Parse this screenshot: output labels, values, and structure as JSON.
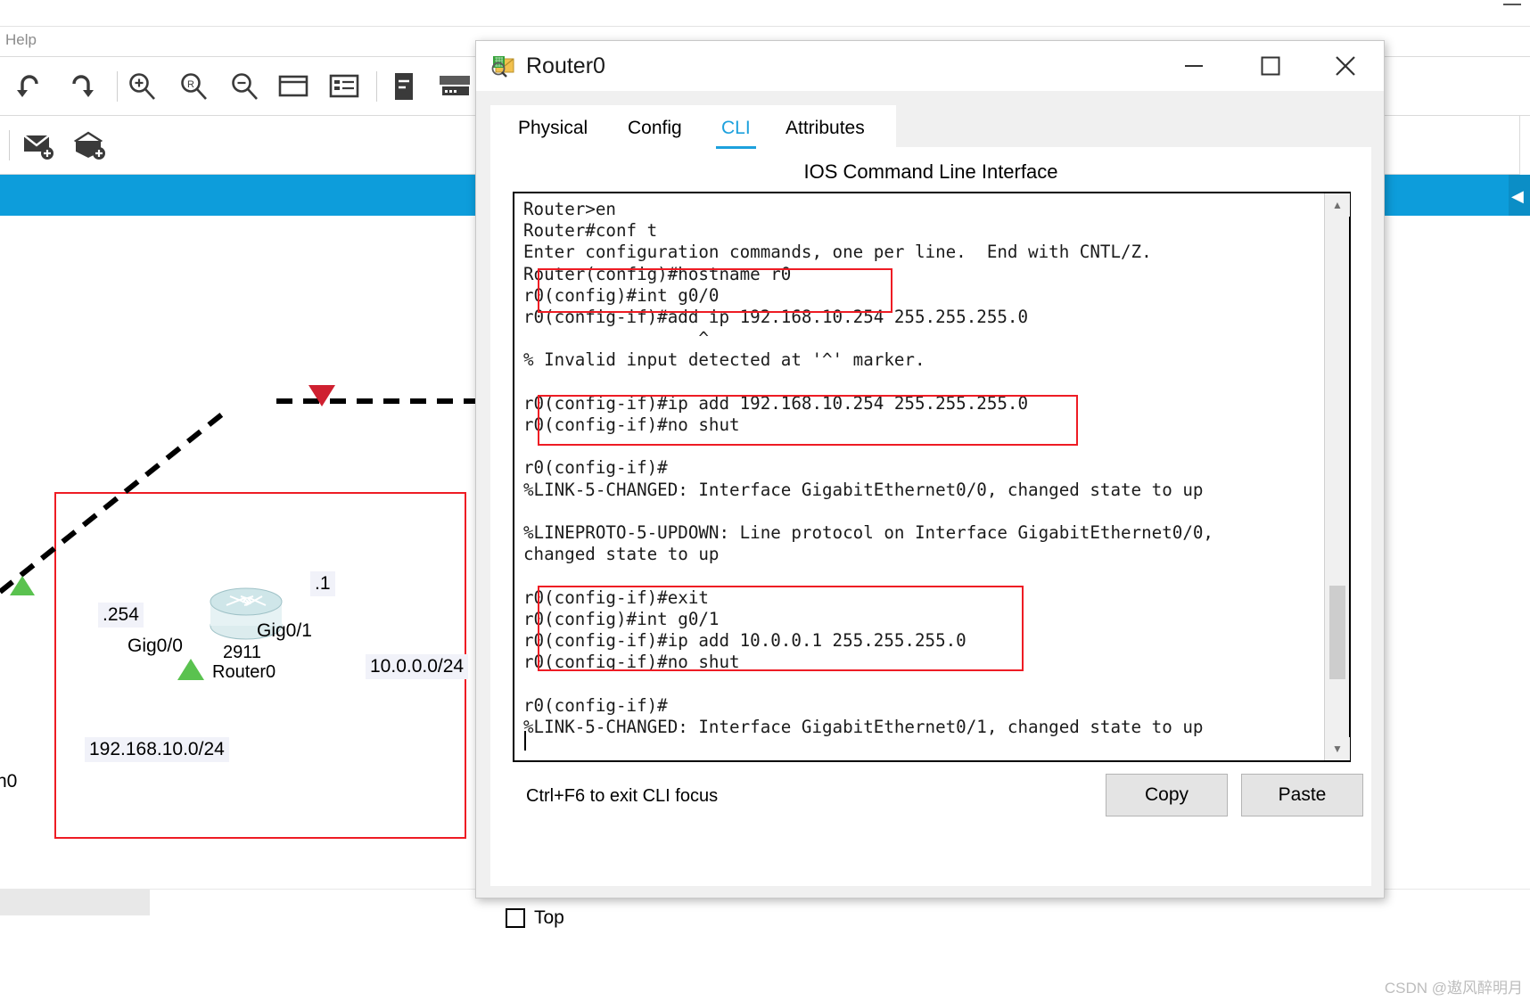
{
  "app": {
    "menu_label": "Help",
    "toolbar_row1_icons": [
      "undo-icon",
      "redo-icon",
      "zoom-in-icon",
      "zoom-reset-icon",
      "zoom-out-icon",
      "window-icon",
      "palette-list-icon",
      "notes-icon",
      "device-stack-icon"
    ],
    "toolbar_row2_icons": [
      "add-simple-pdu-icon",
      "add-complex-pdu-icon"
    ]
  },
  "topology": {
    "device_model": "2911",
    "device_name": "Router0",
    "labels": {
      "left_ip_suffix": ".254",
      "left_interface": "Gig0/0",
      "right_ip_suffix": ".1",
      "right_interface": "Gig0/1",
      "left_network": "192.168.10.0/24",
      "right_network": "10.0.0.0/24",
      "offscreen_interface": "n0"
    },
    "selection_color": "#ee1c24"
  },
  "dialog": {
    "title": "Router0",
    "window_buttons": {
      "minimize": "minimize-icon",
      "maximize": "maximize-icon",
      "close": "close-icon"
    },
    "tabs": [
      {
        "label": "Physical",
        "active": false
      },
      {
        "label": "Config",
        "active": false
      },
      {
        "label": "CLI",
        "active": true
      },
      {
        "label": "Attributes",
        "active": false
      }
    ],
    "cli_heading": "IOS Command Line Interface",
    "hint": "Ctrl+F6 to exit CLI focus",
    "buttons": {
      "copy": "Copy",
      "paste": "Paste"
    },
    "footer": {
      "top_checkbox_label": "Top",
      "top_checked": false
    },
    "accent_color": "#1da1dd"
  },
  "terminal": {
    "lines": [
      "Router>en",
      "Router#conf t",
      "Enter configuration commands, one per line.  End with CNTL/Z.",
      "Router(config)#hostname r0",
      "r0(config)#int g0/0",
      "r0(config-if)#add ip 192.168.10.254 255.255.255.0",
      "                 ^",
      "% Invalid input detected at '^' marker.",
      "",
      "r0(config-if)#ip add 192.168.10.254 255.255.255.0",
      "r0(config-if)#no shut",
      "",
      "r0(config-if)#",
      "%LINK-5-CHANGED: Interface GigabitEthernet0/0, changed state to up",
      "",
      "%LINEPROTO-5-UPDOWN: Line protocol on Interface GigabitEthernet0/0,",
      "changed state to up",
      "",
      "r0(config-if)#exit",
      "r0(config)#int g0/1",
      "r0(config-if)#ip add 10.0.0.1 255.255.255.0",
      "r0(config-if)#no shut",
      "",
      "r0(config-if)#",
      "%LINK-5-CHANGED: Interface GigabitEthernet0/1, changed state to up"
    ]
  },
  "watermark": "CSDN @遨风醉明月"
}
